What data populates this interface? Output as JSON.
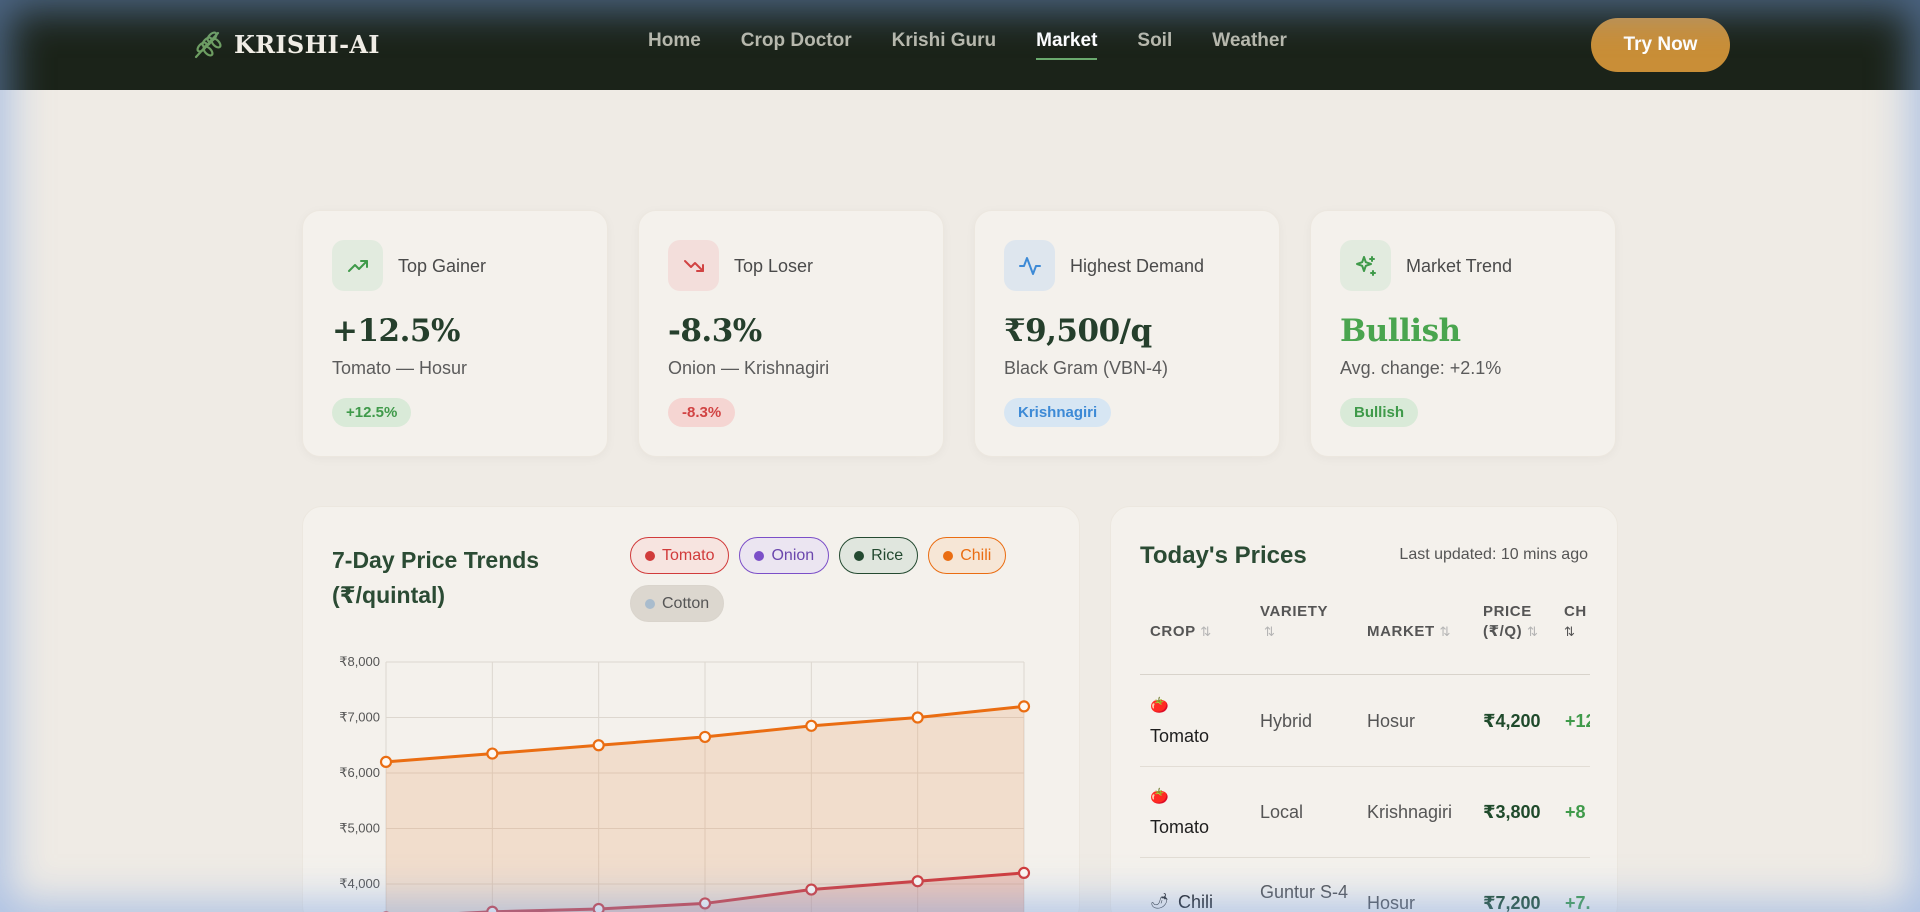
{
  "brand": {
    "name": "KRISHI-AI"
  },
  "nav": {
    "links": [
      {
        "label": "Home"
      },
      {
        "label": "Crop Doctor"
      },
      {
        "label": "Krishi Guru"
      },
      {
        "label": "Market"
      },
      {
        "label": "Soil"
      },
      {
        "label": "Weather"
      }
    ],
    "active": "Market",
    "cta": "Try Now"
  },
  "stats": [
    {
      "label": "Top Gainer",
      "value": "+12.5%",
      "sub": "Tomato — Hosur",
      "badge": "+12.5%",
      "icon": "trending-up-icon",
      "accent": "#3f9a4a"
    },
    {
      "label": "Top Loser",
      "value": "-8.3%",
      "sub": "Onion — Krishnagiri",
      "badge": "-8.3%",
      "icon": "trending-down-icon",
      "accent": "#d14343"
    },
    {
      "label": "Highest Demand",
      "value": "₹9,500/q",
      "sub": "Black Gram (VBN-4)",
      "badge": "Krishnagiri",
      "icon": "activity-icon",
      "accent": "#3d8ad6"
    },
    {
      "label": "Market Trend",
      "value": "Bullish",
      "sub": "Avg. change: +2.1%",
      "badge": "Bullish",
      "icon": "sparkle-icon",
      "accent": "#3f9a4a"
    }
  ],
  "chart_card": {
    "title": "7-Day Price Trends (₹/quintal)",
    "legend": [
      {
        "name": "Tomato",
        "color": "#d13b3b"
      },
      {
        "name": "Onion",
        "color": "#7b4fc8"
      },
      {
        "name": "Rice",
        "color": "#244a31"
      },
      {
        "name": "Chili",
        "color": "#ea6d12"
      },
      {
        "name": "Cotton",
        "color": "#a9bccd"
      }
    ]
  },
  "chart_data": {
    "type": "area",
    "title": "7-Day Price Trends (₹/quintal)",
    "y_ticks": [
      "₹8,000",
      "₹7,000",
      "₹6,000",
      "₹5,000",
      "₹4,000"
    ],
    "ylim": [
      3600,
      8000
    ],
    "grid": true,
    "series": [
      {
        "name": "Chili",
        "color": "#ea6d12",
        "values": [
          6200,
          6350,
          6500,
          6650,
          6850,
          7000,
          7200
        ]
      },
      {
        "name": "Tomato",
        "color": "#d13b3b",
        "values": [
          3400,
          3500,
          3550,
          3650,
          3900,
          4050,
          4200
        ]
      }
    ]
  },
  "prices": {
    "title": "Today's Prices",
    "updated": "Last updated: 10 mins ago",
    "columns": [
      "CROP",
      "VARIETY",
      "MARKET",
      "PRICE (₹/Q)",
      "CH"
    ],
    "rows": [
      {
        "emoji": "🍅",
        "crop": "Tomato",
        "variety": "Hybrid",
        "market": "Hosur",
        "price": "₹4,200",
        "change": "+12"
      },
      {
        "emoji": "🍅",
        "crop": "Tomato",
        "variety": "Local",
        "market": "Krishnagiri",
        "price": "₹3,800",
        "change": "+8"
      },
      {
        "emoji": "🌶",
        "crop": "Chili",
        "variety": "Guntur S-4",
        "market": "Hosur",
        "price": "₹7,200",
        "change": "+7."
      }
    ]
  }
}
